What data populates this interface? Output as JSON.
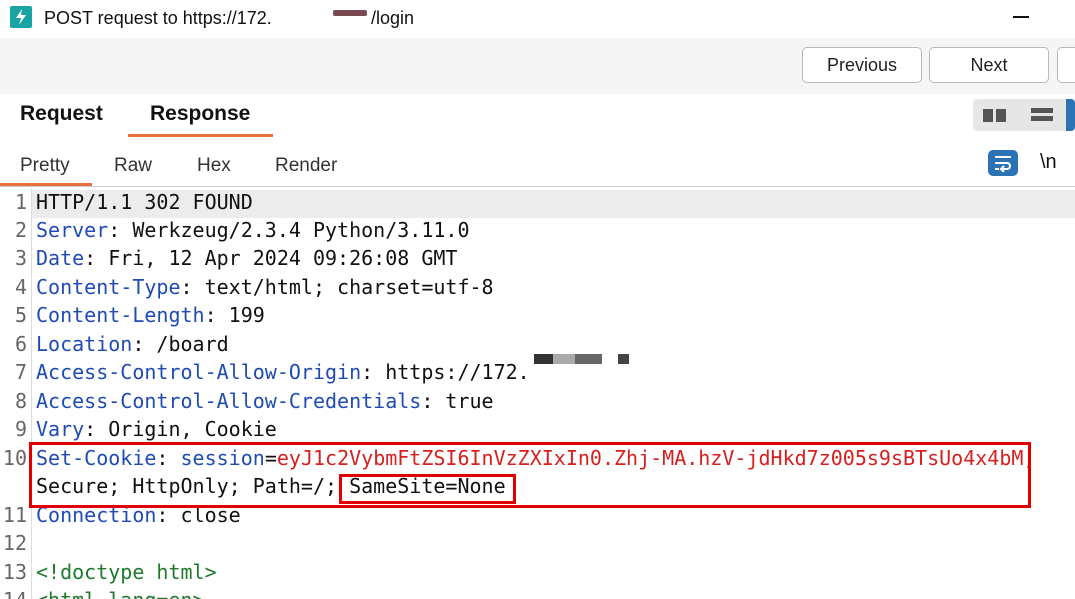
{
  "window": {
    "title": "POST request to https://172.",
    "title_suffix": "/login"
  },
  "nav": {
    "previous": "Previous",
    "next": "Next"
  },
  "tabs": [
    {
      "label": "Request"
    },
    {
      "label": "Response",
      "active": true
    }
  ],
  "subtabs": [
    {
      "label": "Pretty",
      "active": true
    },
    {
      "label": "Raw"
    },
    {
      "label": "Hex"
    },
    {
      "label": "Render"
    }
  ],
  "toggles": {
    "newline": "\\n"
  },
  "editor": {
    "line_numbers": [
      "1",
      "2",
      "3",
      "4",
      "5",
      "6",
      "7",
      "8",
      "9",
      "10",
      "",
      "11",
      "12",
      "13",
      "14"
    ],
    "lines": [
      {
        "text": "HTTP/1.1 302 FOUND"
      },
      {
        "key": "Server",
        "value": " Werkzeug/2.3.4 Python/3.11.0"
      },
      {
        "key": "Date",
        "value": " Fri, 12 Apr 2024 09:26:08 GMT"
      },
      {
        "key": "Content-Type",
        "value": " text/html; charset=utf-8"
      },
      {
        "key": "Content-Length",
        "value": " 199"
      },
      {
        "key": "Location",
        "value": " /board"
      },
      {
        "key": "Access-Control-Allow-Origin",
        "value": " https://172."
      },
      {
        "key": "Access-Control-Allow-Credentials",
        "value": " true"
      },
      {
        "key": "Vary",
        "value": " Origin, Cookie"
      },
      {
        "key": "Set-Cookie",
        "cookie_name": "session",
        "cookie_value": "eyJ1c2VybmFtZSI6InVzZXIxIn0.Zhj-MA.hzV-jdHkd7z005s9sBTsUo4x4bM",
        "sep": ";"
      },
      {
        "text": "Secure; HttpOnly; Path=/; ",
        "samesite": "SameSite=None"
      },
      {
        "key": "Connection",
        "value": " close"
      },
      {
        "text": ""
      },
      {
        "tag": "<!doctype html>"
      },
      {
        "tag": "<html lang=en>"
      }
    ]
  },
  "colors": {
    "accent": "#e8703a",
    "key": "#1f4bb3",
    "highlight_box": "#e00000",
    "cookie_value": "#d61f1f",
    "selected_blue": "#2b73b5"
  }
}
